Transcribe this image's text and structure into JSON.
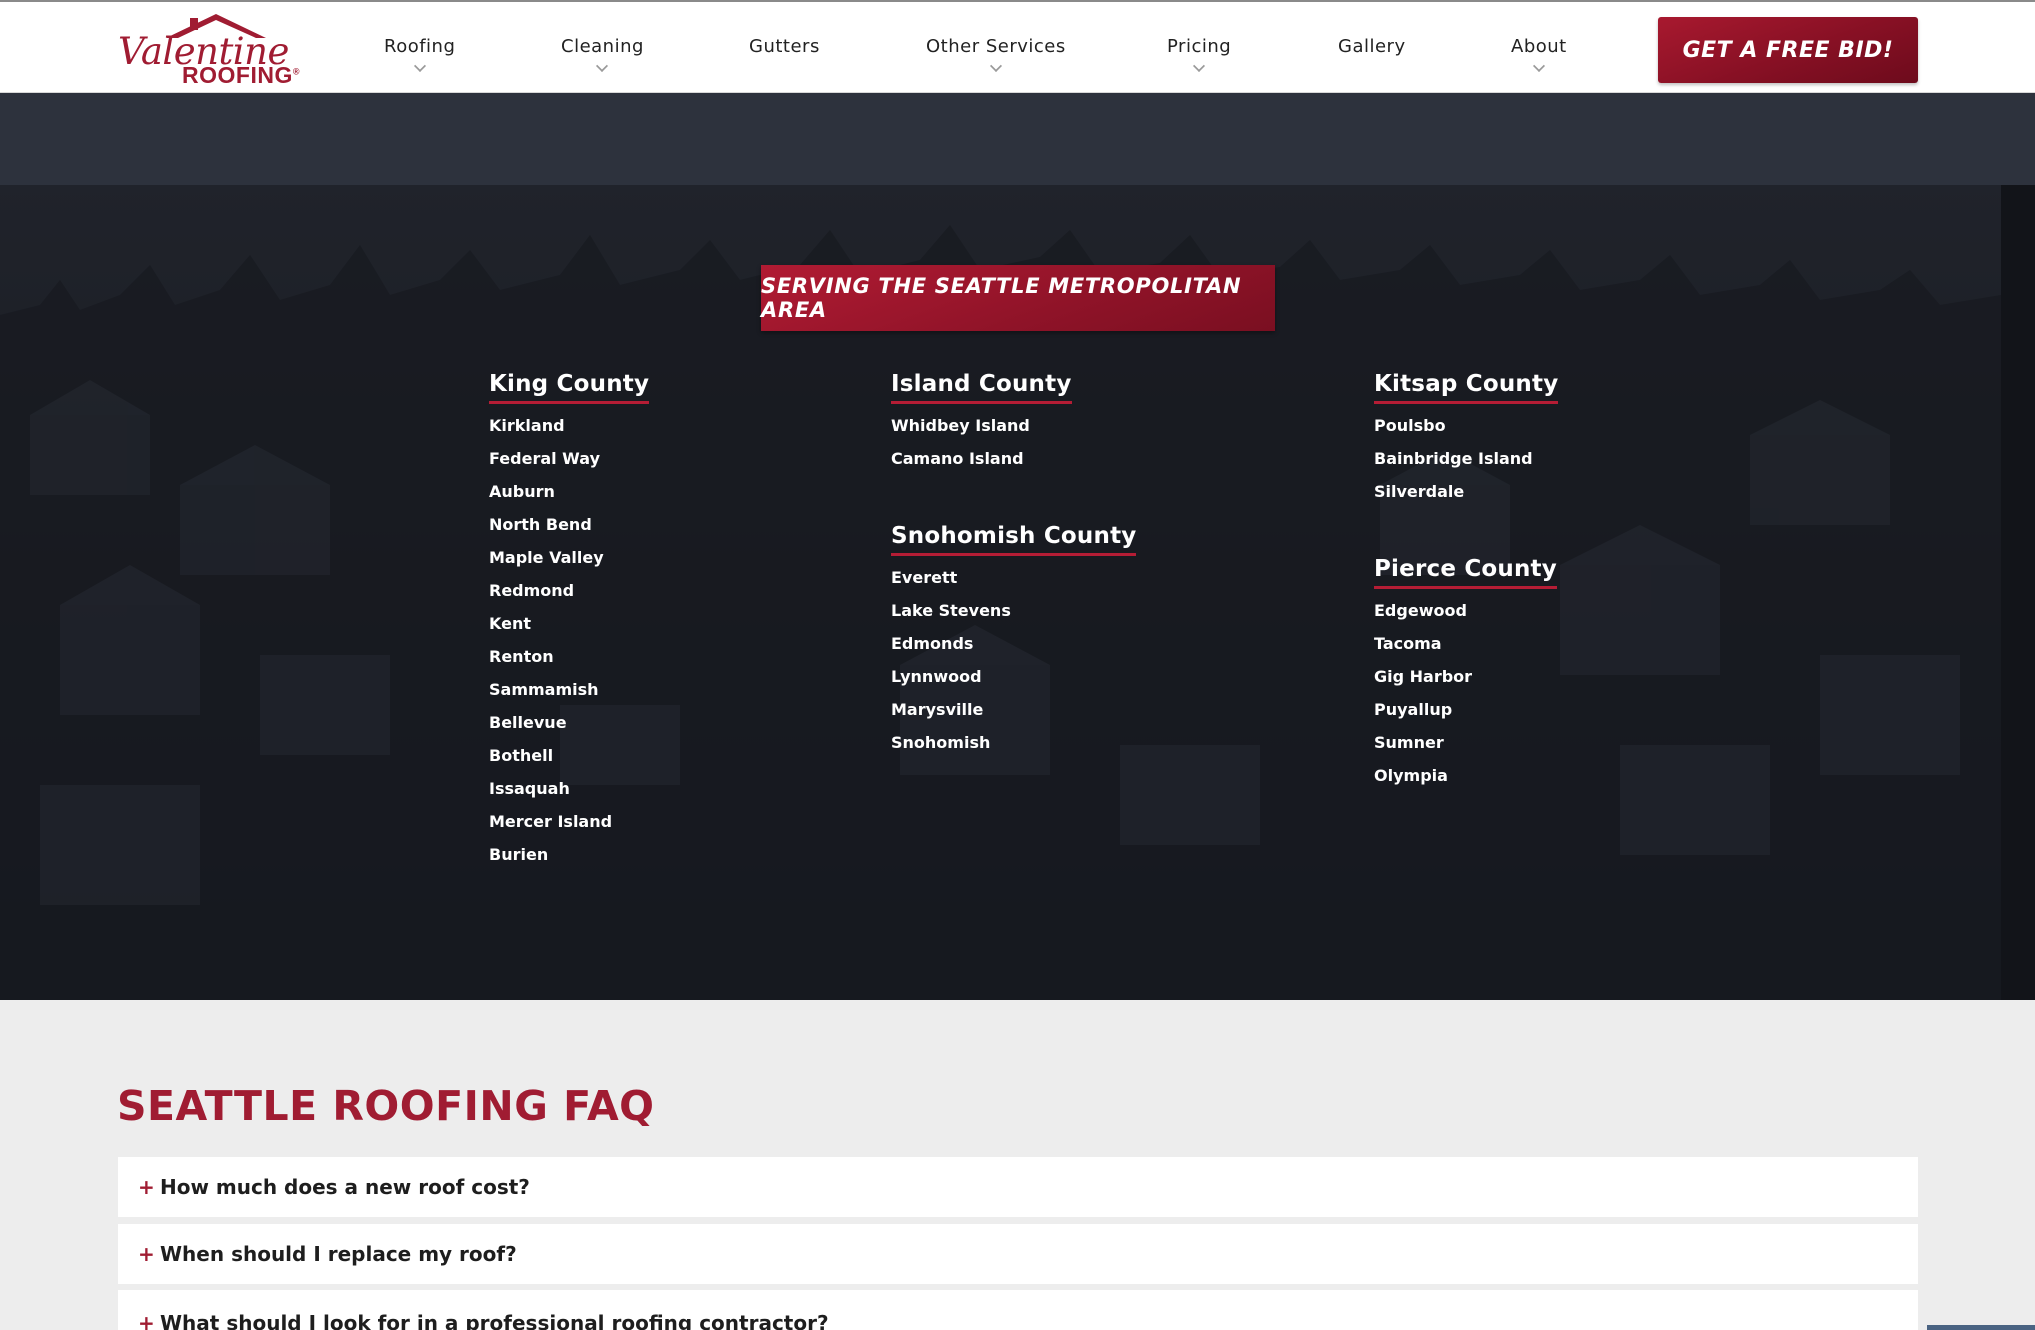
{
  "logo": {
    "script_text": "Valentine",
    "word_text": "ROOFING",
    "mark": "®"
  },
  "nav": {
    "items": [
      {
        "label": "Roofing",
        "has_dropdown": true
      },
      {
        "label": "Cleaning",
        "has_dropdown": true
      },
      {
        "label": "Gutters",
        "has_dropdown": false
      },
      {
        "label": "Other Services",
        "has_dropdown": true
      },
      {
        "label": "Pricing",
        "has_dropdown": true
      },
      {
        "label": "Gallery",
        "has_dropdown": false
      },
      {
        "label": "About",
        "has_dropdown": true
      }
    ],
    "cta_label": "GET A FREE BID!"
  },
  "service_area": {
    "banner": "SERVING THE SEATTLE METROPOLITAN AREA",
    "counties": {
      "king": {
        "name": "King County",
        "cities": [
          "Kirkland",
          "Federal Way",
          "Auburn",
          "North Bend",
          "Maple Valley",
          "Redmond",
          "Kent",
          "Renton",
          "Sammamish",
          "Bellevue",
          "Bothell",
          "Issaquah",
          "Mercer Island",
          "Burien"
        ]
      },
      "island": {
        "name": "Island County",
        "cities": [
          "Whidbey Island",
          "Camano Island"
        ]
      },
      "snohomish": {
        "name": "Snohomish County",
        "cities": [
          "Everett",
          "Lake Stevens",
          "Edmonds",
          "Lynnwood",
          "Marysville",
          "Snohomish"
        ]
      },
      "kitsap": {
        "name": "Kitsap County",
        "cities": [
          "Poulsbo",
          "Bainbridge Island",
          "Silverdale"
        ]
      },
      "pierce": {
        "name": "Pierce County",
        "cities": [
          "Edgewood",
          "Tacoma",
          "Gig Harbor",
          "Puyallup",
          "Sumner",
          "Olympia"
        ]
      }
    }
  },
  "faq": {
    "title": "SEATTLE ROOFING FAQ",
    "items": [
      {
        "question": "How much does a new roof cost?"
      },
      {
        "question": "When should I replace my roof?"
      },
      {
        "question": "What should I look for in a professional roofing contractor?"
      }
    ]
  },
  "colors": {
    "brand_red": "#a01c32",
    "hero_dark": "#1f232b",
    "page_bg": "#ededed"
  }
}
